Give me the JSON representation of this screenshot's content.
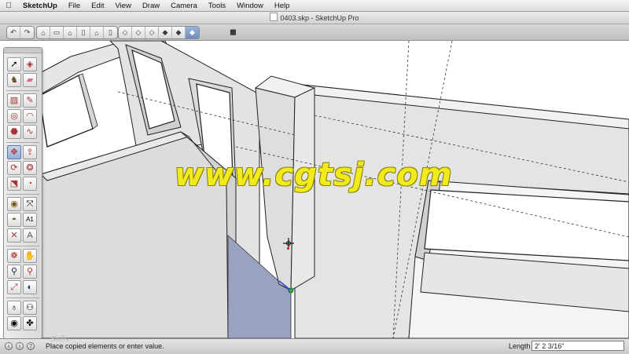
{
  "menubar": {
    "apple_icon": "",
    "items": [
      "SketchUp",
      "File",
      "Edit",
      "View",
      "Draw",
      "Camera",
      "Tools",
      "Window",
      "Help"
    ]
  },
  "window": {
    "title": "0403.skp - SketchUp Pro"
  },
  "toolbar": {
    "groups": [
      {
        "buttons": [
          "undo-icon",
          "redo-icon"
        ]
      },
      {
        "buttons": [
          "iso-view-icon",
          "top-view-icon",
          "front-view-icon",
          "right-view-icon",
          "back-view-icon",
          "left-view-icon"
        ]
      },
      {
        "buttons": [
          "xray-style-icon",
          "wireframe-style-icon",
          "hidden-line-style-icon",
          "shaded-style-icon",
          "shaded-texture-style-icon",
          "monochrome-style-icon"
        ],
        "active_index": 5
      }
    ],
    "extra_button": "component-icon"
  },
  "palette": {
    "tools": [
      "select-tool-icon",
      "make-component-icon",
      "paint-bucket-icon",
      "eraser-icon",
      "rectangle-icon",
      "line-icon",
      "circle-icon",
      "arc-icon",
      "polygon-icon",
      "freehand-icon",
      "move-icon",
      "push-pull-icon",
      "rotate-icon",
      "follow-me-icon",
      "scale-icon",
      "offset-icon",
      "tape-measure-icon",
      "dimension-icon",
      "protractor-icon",
      "text-icon",
      "axes-icon",
      "3d-text-icon",
      "orbit-icon",
      "pan-icon",
      "zoom-icon",
      "zoom-window-icon",
      "zoom-extents-icon",
      "previous-view-icon",
      "position-camera-icon",
      "walk-icon",
      "look-around-icon",
      "section-plane-icon"
    ],
    "active_tool": "move-icon"
  },
  "watermark": "www.cgtsj.com",
  "statusbar": {
    "faint_text": "Skills",
    "message": "Place copied elements or enter value.",
    "vcb_label": "Length",
    "vcb_value": "2' 2 3/16\""
  },
  "colors": {
    "floor": "#99a2be",
    "wall_face": "#e4e4e4",
    "watermark": "#f2ea1c",
    "selection": "#3a5bcf"
  }
}
